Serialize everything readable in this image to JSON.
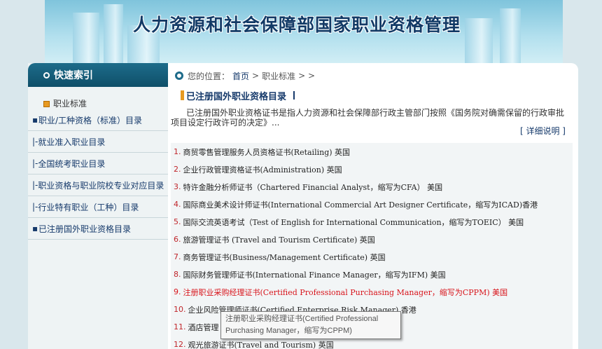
{
  "banner": {
    "title": "人力资源和社会保障部国家职业资格管理"
  },
  "sidebar": {
    "title": "快速索引",
    "category": "职业标准",
    "items": [
      {
        "mark": "▪",
        "label": "职业/工种资格（标准）目录"
      },
      {
        "mark": "|-",
        "label": "就业准入职业目录"
      },
      {
        "mark": "|-",
        "label": "全国统考职业目录"
      },
      {
        "mark": "|-",
        "label": "职业资格与职业院校专业对应目录"
      },
      {
        "mark": "|-",
        "label": "行业特有职业（工种）目录"
      },
      {
        "mark": "▪",
        "label": "已注册国外职业资格目录"
      }
    ]
  },
  "breadcrumb": {
    "prefix": "您的位置：",
    "home": "首页",
    "sep1": ">",
    "current": "职业标准",
    "sep2": "> >"
  },
  "section": {
    "title": "已注册国外职业资格目录"
  },
  "intro": "已注册国外职业资格证书是指人力资源和社会保障部行政主管部门按照《国务院对确需保留的行政审批项目设定行政许可的决定》...",
  "more_link": "[ 详细说明 ]",
  "list": [
    {
      "num": "1.",
      "text": "商贸零售管理服务人员资格证书(Retailing) 英国"
    },
    {
      "num": "2.",
      "text": "企业行政管理资格证书(Administration) 英国"
    },
    {
      "num": "3.",
      "text": "特许金融分析师证书（Chartered Financial Analyst，缩写为CFA） 美国"
    },
    {
      "num": "4.",
      "text": "国际商业美术设计师证书(International Commercial Art Designer Certificate，缩写为ICAD)香港"
    },
    {
      "num": "5.",
      "text": "国际交流英语考试（Test of English for International Communication，缩写为TOEIC） 美国"
    },
    {
      "num": "6.",
      "text": "旅游管理证书 (Travel and Tourism Certificate) 英国"
    },
    {
      "num": "7.",
      "text": "商务管理证书(Business/Management Certificate) 英国"
    },
    {
      "num": "8.",
      "text": "国际财务管理师证书(International Finance Manager，缩写为IFM) 美国"
    },
    {
      "num": "9.",
      "text": "注册职业采购经理证书(Certified Professional Purchasing Manager，缩写为CPPM) 美国",
      "highlight": true
    },
    {
      "num": "10.",
      "text": "企业风险管理师证书(Certified Enterprise Risk Manager) 香港"
    },
    {
      "num": "11.",
      "text": "酒店管理"
    },
    {
      "num": "12.",
      "text": "观光旅游证书(Travel and Tourism) 英国"
    }
  ],
  "tooltip": {
    "line1": "注册职业采购经理证书(Certified Professional",
    "line2": "Purchasing Manager，缩写为CPPM)"
  },
  "colors": {
    "header_teal": "#0f4f69",
    "link_blue": "#163a6b",
    "highlight_red": "#d8141b",
    "accent_orange": "#e79a22"
  }
}
